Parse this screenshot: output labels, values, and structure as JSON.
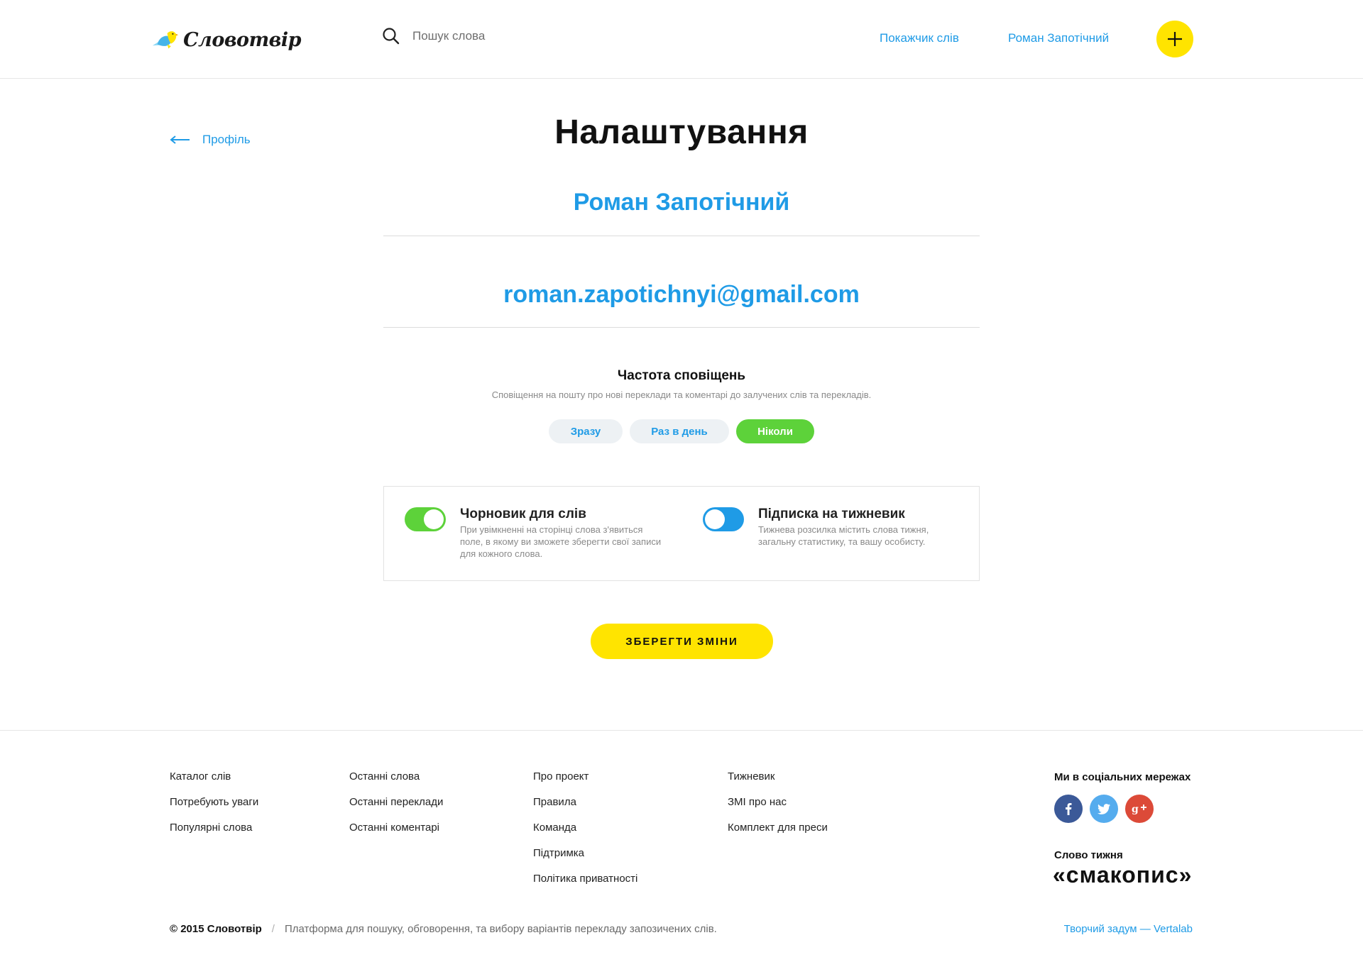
{
  "header": {
    "logo_text": "Словотвір",
    "search_placeholder": "Пошук слова",
    "nav_index": "Покажчик слів",
    "nav_user": "Роман Запотічний"
  },
  "main": {
    "back_label": "Профіль",
    "title": "Налаштування",
    "name_value": "Роман Запотічний",
    "email_value": "roman.zapotichnyi@gmail.com",
    "frequency": {
      "title": "Частота сповіщень",
      "description": "Сповіщення на пошту про нові переклади та коментарі до залучених слів та перекладів.",
      "options": [
        "Зразу",
        "Раз в день",
        "Ніколи"
      ],
      "selected": "Ніколи"
    },
    "toggles": [
      {
        "title": "Чорновик для слів",
        "description": "При увімкненні на сторінці слова з'явиться поле, в якому ви зможете зберегти свої записи для кожного слова.",
        "on": true
      },
      {
        "title": "Підписка на тижневик",
        "description": "Тижнева розсилка містить слова тижня, загальну статистику, та вашу особисту.",
        "on": false
      }
    ],
    "save_label": "ЗБЕРЕГТИ ЗМІНИ"
  },
  "footer": {
    "col1": [
      "Каталог слів",
      "Потребують уваги",
      "Популярні слова"
    ],
    "col2": [
      "Останні слова",
      "Останні переклади",
      "Останні коментарі"
    ],
    "col3": [
      "Про проект",
      "Правила",
      "Команда",
      "Підтримка",
      "Політика приватності"
    ],
    "col4": [
      "Тижневик",
      "ЗМІ про нас",
      "Комплект для преси"
    ],
    "social_title": "Ми в соціальних мережах",
    "word_of_week_title": "Слово тижня",
    "word_of_week": "«смакопис»",
    "copyright_brand": "© 2015 Словотвір",
    "copyright_sep": "/",
    "copyright_text": "Платформа для пошуку, обговорення, та вибору варіантів перекладу запозичених слів.",
    "credit": "Творчий задум — Vertalab"
  },
  "colors": {
    "accent_blue": "#1f9be6",
    "accent_yellow": "#ffe400",
    "accent_green": "#5dd23a"
  }
}
